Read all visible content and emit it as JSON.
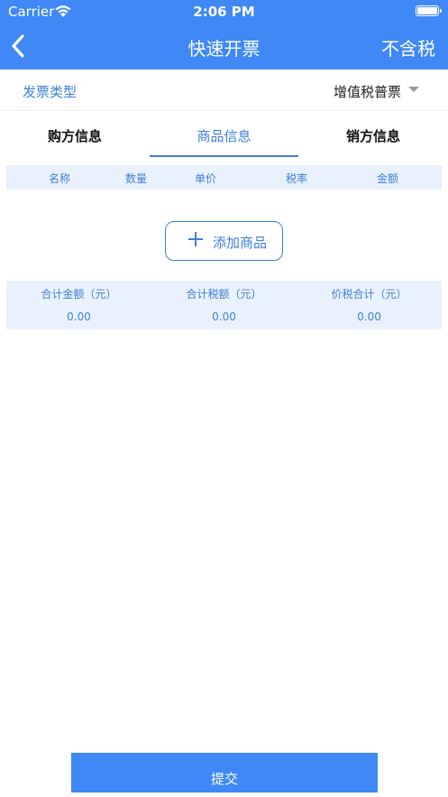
{
  "status_bar": {
    "carrier": "Carrier",
    "time": "2:06 PM"
  },
  "nav": {
    "title": "快速开票",
    "right_label": "不含税"
  },
  "invoice_type": {
    "label": "发票类型",
    "value": "增值税普票"
  },
  "tabs": [
    {
      "label": "购方信息",
      "active": false
    },
    {
      "label": "商品信息",
      "active": true
    },
    {
      "label": "销方信息",
      "active": false
    }
  ],
  "goods_table": {
    "columns": [
      "名称",
      "数量",
      "单价",
      "税率",
      "金额"
    ]
  },
  "add_goods_label": "添加商品",
  "totals": [
    {
      "label": "合计金额（元）",
      "value": "0.00"
    },
    {
      "label": "合计税额（元）",
      "value": "0.00"
    },
    {
      "label": "价税合计（元）",
      "value": "0.00"
    }
  ],
  "submit_label": "提交",
  "colors": {
    "primary": "#3f88f5",
    "accent_text": "#3f7fd6",
    "light_bg": "#e9f1fd"
  }
}
